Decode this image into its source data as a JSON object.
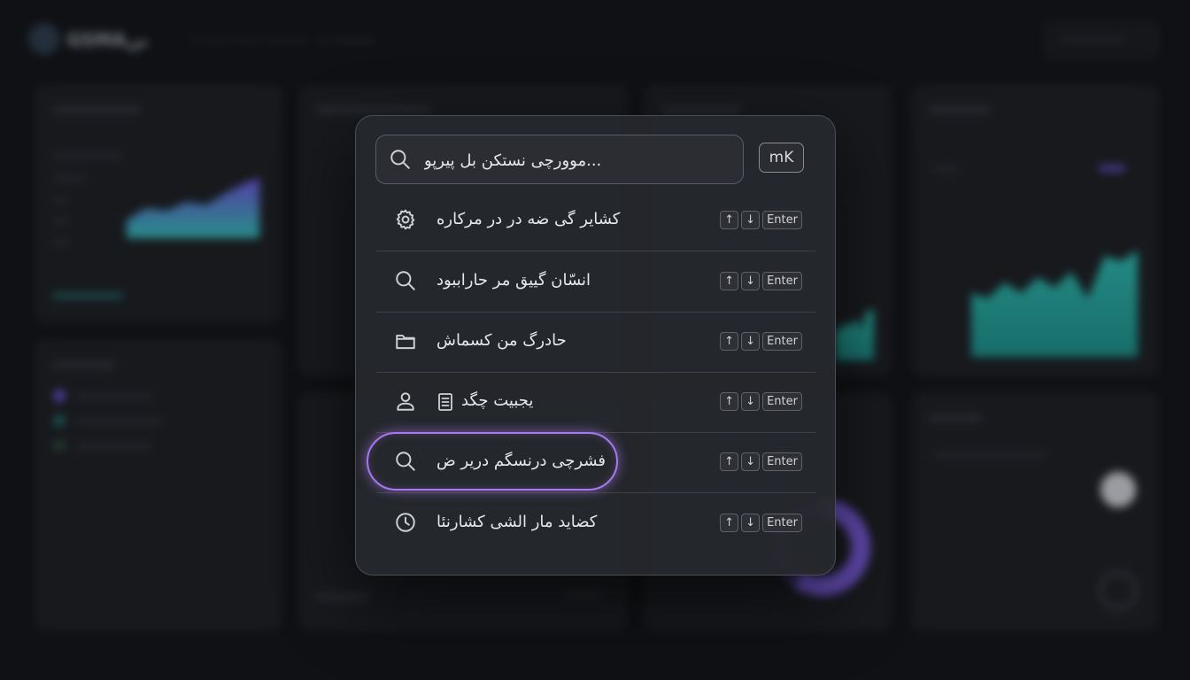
{
  "background": {
    "logo_text": "GSMAنن",
    "nav": [
      "— —— ——— ————",
      "— ————"
    ],
    "top_button": "——————"
  },
  "palette": {
    "search": {
      "value": "موورچی نستکن بل پیرپو...",
      "icon": "search-icon"
    },
    "toggle_label": "mK",
    "key_labels": {
      "up": "↑",
      "down": "↓",
      "enter": "Enter"
    },
    "items": [
      {
        "label": "کشایر گی ضه در  در مرکاره",
        "icon": "gear-icon"
      },
      {
        "label": "انسّان گییق مر حاراببود",
        "icon": "search-icon"
      },
      {
        "label": "حادرگ من کسماش",
        "icon": "folder-icon"
      },
      {
        "label": "یجبیت چگد",
        "icon": "user-icon",
        "secondary_icon": "document-icon"
      },
      {
        "label": "فشرچی درنسگم دریر ض",
        "icon": "search-icon",
        "highlighted": true
      },
      {
        "label": "کضاید مار الشی کشارنئا",
        "icon": "clock-icon"
      }
    ]
  },
  "colors": {
    "accent": "#a778f0",
    "chart_purple": "#6b4fd8",
    "chart_teal": "#2bb3aa"
  }
}
